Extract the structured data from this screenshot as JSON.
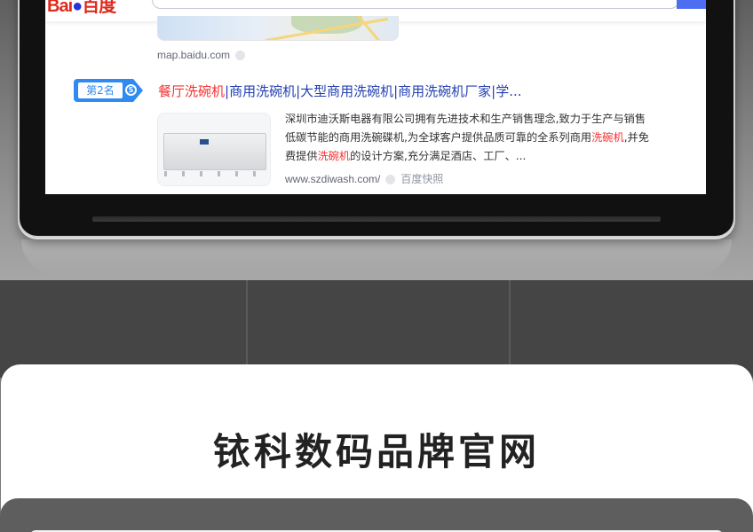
{
  "search_page": {
    "logo": {
      "bai": "Bai",
      "du": "百度"
    },
    "map_result": {
      "url": "map.baidu.com"
    },
    "result2": {
      "rank_label": "第2名",
      "title_prefix_hl": "餐厅洗碗机",
      "title_rest": "|商用洗碗机|大型商用洗碗机|商用洗碗机厂家|学...",
      "snippet_part1": "深圳市迪沃斯电器有限公司拥有先进技术和生产销售理念,致力于生产与销售低碳节能的商用洗碗碟机,为全球客户提供品质可靠的全系列商用",
      "snippet_hl1": "洗碗机",
      "snippet_part2": ",并免费提供",
      "snippet_hl2": "洗碗机",
      "snippet_part3": "的设计方案,充分满足酒店、工厂、...",
      "url": "www.szdiwash.com/",
      "cache_label": "百度快照"
    }
  },
  "brand_section": {
    "title": "铱科数码品牌官网"
  },
  "colors": {
    "accent_blue": "#2f8bf2",
    "link_blue": "#2440b3",
    "highlight_red": "#f73131"
  }
}
